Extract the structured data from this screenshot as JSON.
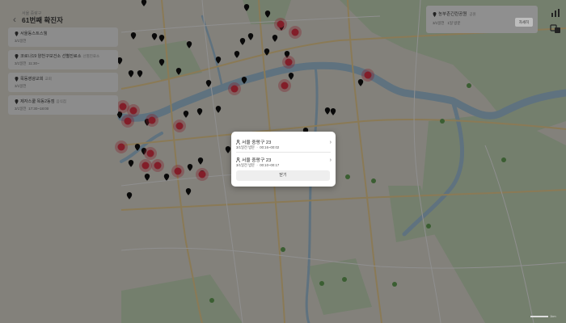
{
  "panel": {
    "subtitle": "서울 중랑구",
    "title": "61번째 확진자",
    "back_icon": "chevron-left-icon",
    "visits": [
      {
        "name": "서울동스트스웰",
        "tag": "",
        "date": "3/1일전",
        "time": ""
      },
      {
        "name": "코로나19 양천구보건소 선별진료소",
        "tag": "선별진료소",
        "date": "3/1일전",
        "time": "11:30~"
      },
      {
        "name": "목동영광교회",
        "tag": "교회",
        "date": "3/1일전",
        "time": ""
      },
      {
        "name": "제자스쿨 목동2동점",
        "tag": "음식점",
        "date": "3/1일전",
        "time": "17:30~18:00"
      }
    ]
  },
  "right_card": {
    "name": "농부촌긴린공원",
    "tag": "공원",
    "date": "3/1일전",
    "visit": "1일 방문",
    "button": "자세히"
  },
  "top_icons": [
    "chart-icon",
    "translate-icon"
  ],
  "modal": {
    "rows": [
      {
        "title": "서울 중랑구 23",
        "date": "3/1일전 방문",
        "time": "00:16~00:02"
      },
      {
        "title": "서울 중랑구 23",
        "date": "3/1일전 방문",
        "time": "00:10~00:17"
      }
    ],
    "close": "닫기"
  },
  "map": {
    "scale_label": "1km",
    "colors": {
      "red_marker": "#e8364a",
      "black_marker": "#111111",
      "river": "#9fc4df"
    }
  }
}
